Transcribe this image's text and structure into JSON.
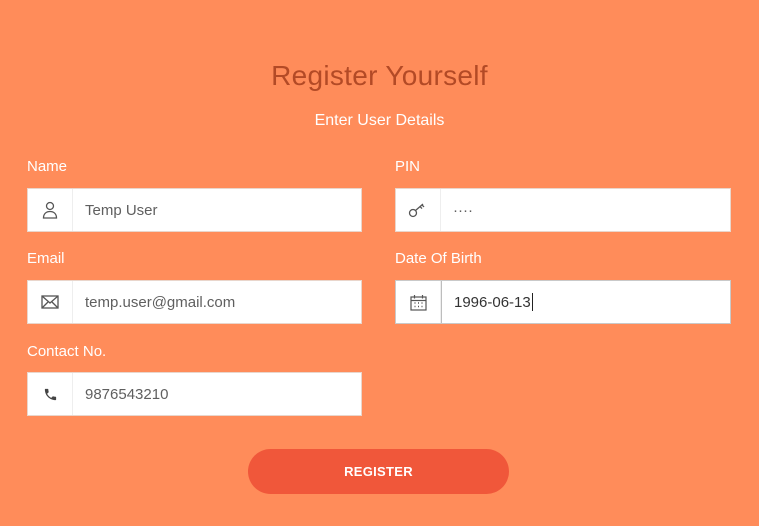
{
  "form": {
    "title": "Register Yourself",
    "subtitle": "Enter User Details",
    "fields": {
      "name": {
        "label": "Name",
        "value": "Temp User",
        "icon": "user-icon"
      },
      "pin": {
        "label": "PIN",
        "value": "····",
        "icon": "key-icon"
      },
      "email": {
        "label": "Email",
        "value": "temp.user@gmail.com",
        "icon": "envelope-icon"
      },
      "dob": {
        "label": "Date Of Birth",
        "value": "1996-06-13",
        "icon": "calendar-icon"
      },
      "contact": {
        "label": "Contact No.",
        "value": "9876543210",
        "icon": "phone-icon"
      }
    },
    "register_label": "REGISTER"
  },
  "colors": {
    "background": "#ff8c5a",
    "title": "#b34a26",
    "button": "#f0573a"
  }
}
